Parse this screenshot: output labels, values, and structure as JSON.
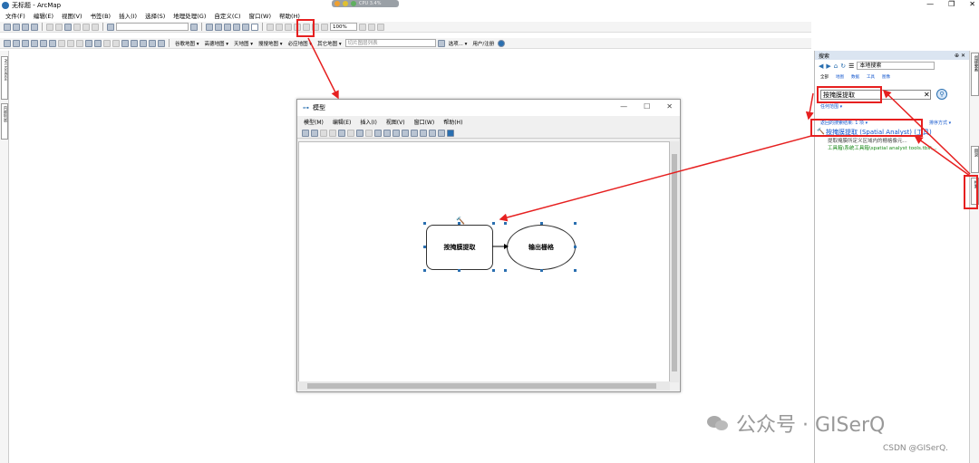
{
  "window": {
    "title": "无标题 - ArcMap"
  },
  "overlay": {
    "text": "CPU 3.4%"
  },
  "menubar": {
    "items": [
      "文件(F)",
      "编辑(E)",
      "视图(V)",
      "书签(B)",
      "插入(I)",
      "选择(S)",
      "地理处理(G)",
      "自定义(C)",
      "窗口(W)",
      "帮助(H)"
    ]
  },
  "toolbar": {
    "zoom": "100%",
    "basemaps": [
      "谷歌地图 ▾",
      "高德地图 ▾",
      "天地图 ▾",
      "搜搜地图 ▾",
      "必应地图 ▾",
      "其它地图 ▾"
    ],
    "tile_list_placeholder": "切片图层列表",
    "options": "选项... ▾",
    "register": "用户/注册"
  },
  "left_tabs": [
    "ArcToolbox",
    "内容列表"
  ],
  "right_tabs": [
    "创建要素",
    "目录",
    "搜索"
  ],
  "search_panel": {
    "title": "搜索",
    "location": "本地搜索",
    "tabs": [
      "全部",
      "地图",
      "数据",
      "工具",
      "图像"
    ],
    "query": "按掩膜提取",
    "any_extent": "任何范围 ▾",
    "related": "返回的搜索结果: 1 项 ▾",
    "sort": "排序方式 ▾",
    "result_title": "按掩膜提取 (Spatial Analyst) (工具)",
    "result_desc": "提取掩膜所定义区域内的栅格像元...",
    "result_path": "工具箱\\系统工具箱\\spatial analyst tools.tbx\\..."
  },
  "model_dialog": {
    "title": "模型",
    "menu": [
      "模型(M)",
      "编辑(E)",
      "插入(I)",
      "视图(V)",
      "窗口(W)",
      "帮助(H)"
    ],
    "tool_node": "按掩膜提取",
    "output_node": "输出栅格"
  },
  "watermark": {
    "text": "公众号 · GISerQ",
    "source": "CSDN @GISerQ."
  }
}
